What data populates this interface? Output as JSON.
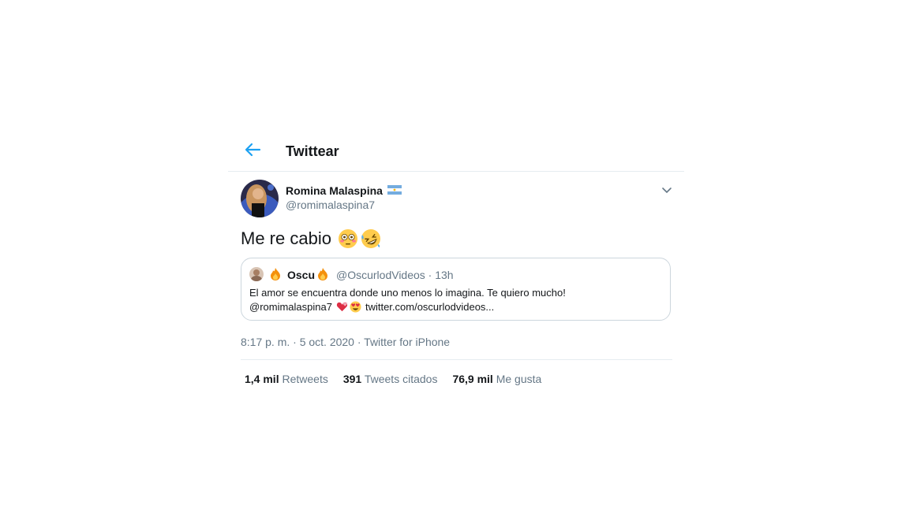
{
  "header": {
    "title": "Twittear"
  },
  "tweet": {
    "author_name": "Romina Malaspina",
    "author_handle": "@romimalaspina7",
    "text": "Me re cabio",
    "timestamp": "8:17 p. m. · 5 oct. 2020 · Twitter for iPhone"
  },
  "quote": {
    "name": "Oscu",
    "handle_time": "@OscurlodVideos · 13h",
    "line1": "El amor se encuentra donde uno menos lo imagina. Te quiero mucho!",
    "line2_mention": "@romimalaspina7",
    "line2_link": "twitter.com/oscurlodvideos..."
  },
  "stats": [
    {
      "value": "1,4 mil",
      "label": "Retweets"
    },
    {
      "value": "391",
      "label": "Tweets citados"
    },
    {
      "value": "76,9 mil",
      "label": "Me gusta"
    }
  ],
  "icons": {
    "back": "back-arrow-icon",
    "menu": "chevron-down-icon",
    "flag": "argentina-flag-icon",
    "emoji_1": "flushed-face-emoji",
    "emoji_2": "rolling-laughing-emoji",
    "fire": "fire-emoji",
    "hearts": "two-hearts-emoji",
    "heart_eyes": "heart-eyes-emoji"
  },
  "colors": {
    "accent": "#1da1f2",
    "text": "#14171a",
    "secondary": "#657786",
    "border": "#e6ecf0"
  }
}
